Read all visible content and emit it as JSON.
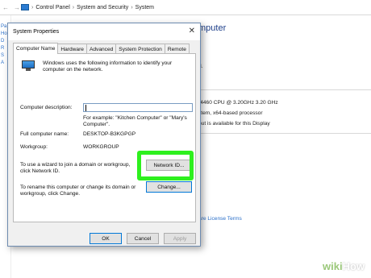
{
  "address_bar": {
    "back": "←",
    "forward": "→",
    "crumbs": [
      "Control Panel",
      "System and Security",
      "System"
    ],
    "separator": "›"
  },
  "background": {
    "left_pane": [
      "Pa",
      "Ho",
      "D",
      "R",
      "S",
      "A"
    ],
    "heading": "mputer",
    "line_d": "d.",
    "processor": "-4460  CPU @ 3.20GHz   3.20 GHz",
    "system_type": "stem, x64-based processor",
    "pen": "put is available for this Display",
    "license_link": "are License Terms"
  },
  "dialog": {
    "title": "System Properties",
    "close": "✕",
    "tabs": [
      "Computer Name",
      "Hardware",
      "Advanced",
      "System Protection",
      "Remote"
    ],
    "active_tab": 0,
    "intro": "Windows uses the following information to identify your computer on the network.",
    "description_label": "Computer description:",
    "description_value": "",
    "example": "For example: \"Kitchen Computer\" or \"Mary's Computer\".",
    "full_name_label": "Full computer name:",
    "full_name_value": "DESKTOP-B3KGPGP",
    "workgroup_label": "Workgroup:",
    "workgroup_value": "WORKGROUP",
    "network_id_text": "To use a wizard to join a domain or workgroup, click Network ID.",
    "network_id_button": "Network ID...",
    "rename_text": "To rename this computer or change its domain or workgroup, click Change.",
    "change_button": "Change...",
    "ok_button": "OK",
    "cancel_button": "Cancel",
    "apply_button": "Apply"
  },
  "watermark": {
    "wiki": "wiki",
    "how": "How"
  },
  "colors": {
    "highlight": "#2ef01e",
    "link": "#2a6fc9",
    "heading": "#1e3f8a"
  }
}
